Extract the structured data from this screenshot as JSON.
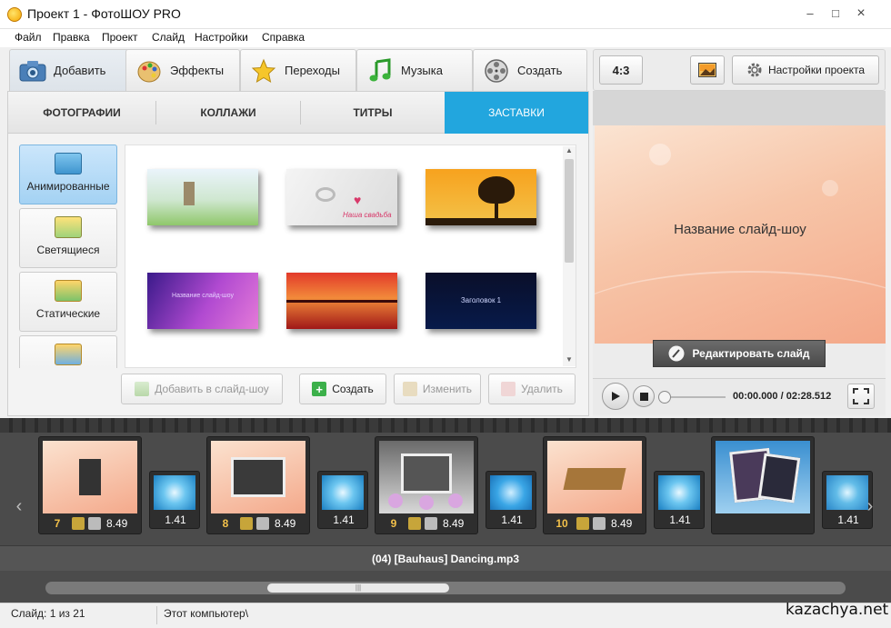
{
  "window": {
    "title": "Проект 1 - ФотоШОУ PRO"
  },
  "menu": [
    "Файл",
    "Правка",
    "Проект",
    "Слайд",
    "Настройки",
    "Справка"
  ],
  "tool_tabs": [
    {
      "label": "Добавить",
      "icon": "camera-icon"
    },
    {
      "label": "Эффекты",
      "icon": "palette-icon"
    },
    {
      "label": "Переходы",
      "icon": "star-icon"
    },
    {
      "label": "Музыка",
      "icon": "music-note-icon"
    },
    {
      "label": "Создать",
      "icon": "film-reel-icon"
    }
  ],
  "right_toolbar": {
    "aspect_ratio": "4:3",
    "project_settings": "Настройки проекта"
  },
  "sub_tabs": [
    "ФОТОГРАФИИ",
    "КОЛЛАЖИ",
    "ТИТРЫ",
    "ЗАСТАВКИ"
  ],
  "categories": [
    "Анимированные",
    "Светящиеся",
    "Статические",
    ""
  ],
  "thumbnails": [
    {
      "style": "nature-castle",
      "caption": ""
    },
    {
      "style": "rings-heart",
      "caption": "Наша свадьба"
    },
    {
      "style": "sunset-tree",
      "caption": ""
    },
    {
      "style": "purple-lights",
      "caption": "Название слайд-шоу"
    },
    {
      "style": "red-sunset",
      "caption": ""
    },
    {
      "style": "dark-title",
      "caption": "Заголовок 1"
    }
  ],
  "actions": {
    "add_to_show": "Добавить в слайд-шоу",
    "create": "Создать",
    "edit": "Изменить",
    "delete": "Удалить"
  },
  "preview": {
    "title": "Название слайд-шоу",
    "edit_slide": "Редактировать слайд",
    "time": "00:00.000 / 02:28.512"
  },
  "slides": [
    {
      "num": "7",
      "duration": "8.49"
    },
    {
      "num": "8",
      "duration": "8.49"
    },
    {
      "num": "9",
      "duration": "8.49"
    },
    {
      "num": "10",
      "duration": "8.49"
    },
    {
      "num": "",
      "duration": ""
    }
  ],
  "transitions": [
    "1.41",
    "1.41",
    "1.41",
    "1.41",
    "1.41"
  ],
  "music_track": "(04) [Bauhaus] Dancing.mp3",
  "scroll_grip": "|||",
  "status": {
    "slide": "Слайд: 1 из 21",
    "location": "Этот компьютер\\"
  },
  "watermark": "kazachya.net",
  "colors": {
    "accent": "#22a6de",
    "strip": "#4b4b4b",
    "slide_number": "#f3c14a"
  }
}
